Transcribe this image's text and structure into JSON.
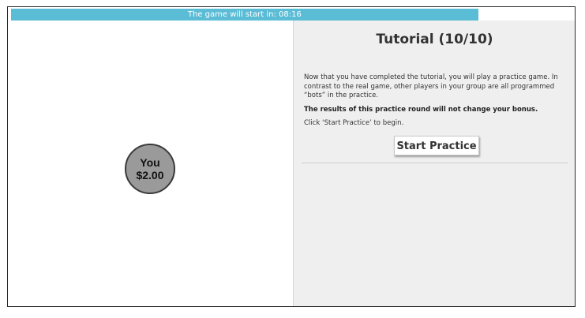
{
  "countdown": {
    "text": "The game will start in: 08:16",
    "progress_fraction": 0.83,
    "color": "#5bbcd6"
  },
  "player": {
    "label": "You",
    "amount": "$2.00"
  },
  "tutorial": {
    "title": "Tutorial (10/10)",
    "intro": "Now that you have completed the tutorial, you will play a practice game. In contrast to the real game, other players in your group are all programmed “bots” in the practice.",
    "warning": "The results of this practice round will not change your bonus.",
    "instruction": "Click ‘Start Practice’ to begin.",
    "start_label": "Start Practice"
  }
}
